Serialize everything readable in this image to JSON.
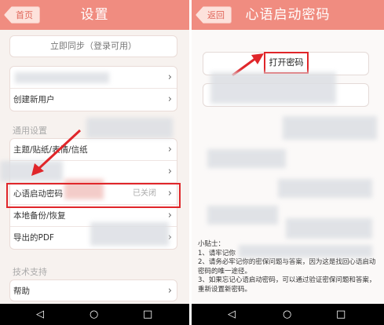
{
  "left": {
    "back_label": "首页",
    "title": "设置",
    "sync_button": "立即同步（登录可用）",
    "create_user": "创建新用户",
    "section_general": "通用设置",
    "theme_item": "主题/贴纸/表情/信纸",
    "password_item": "心语启动密码",
    "password_status": "已关闭",
    "backup_item": "本地备份/恢复",
    "export_item": "导出的PDF",
    "section_tech": "技术支持",
    "help_item": "帮助"
  },
  "right": {
    "back_label": "返回",
    "title": "心语启动密码",
    "open_password": "打开密码",
    "tips_title": "小贴士：",
    "tips": [
      "1、请牢记你",
      "2、请务必牢记你的密保问题与答案，因为这是找回心语启动密码的唯一途径。",
      "3、如果忘记心语启动密码，可以通过验证密保问题和答案，重新设置新密码。"
    ]
  },
  "nav": {
    "back_icon": "◁",
    "home_icon": "○",
    "recent_icon": "□"
  },
  "icons": {
    "chevron": "›",
    "arrow": "arrow-icon"
  },
  "colors": {
    "titlebar": "#f08c80",
    "highlight": "#e0262a",
    "background": "#f7f2ef"
  }
}
